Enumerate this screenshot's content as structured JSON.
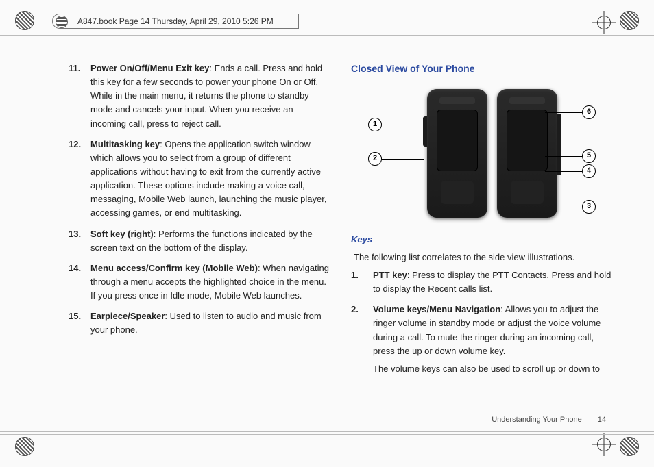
{
  "header": {
    "text": "A847.book  Page 14  Thursday, April 29, 2010  5:26 PM"
  },
  "left_items": [
    {
      "num": "11.",
      "term": "Power On/Off/Menu Exit key",
      "desc": ": Ends a call. Press and hold this key for a few seconds to power your phone On or Off. While in the main menu, it returns the phone to standby mode and cancels your input. When you receive an incoming call, press to reject call."
    },
    {
      "num": "12.",
      "term": "Multitasking key",
      "desc": ": Opens the application switch window which allows you to select from a group of different applications without having to exit from the currently active application. These options include making a voice call, messaging, Mobile Web launch, launching the music player, accessing games, or end multitasking."
    },
    {
      "num": "13.",
      "term": "Soft key (right)",
      "desc": ": Performs the functions indicated by the screen text on the bottom of the display."
    },
    {
      "num": "14.",
      "term": "Menu access/Confirm key (Mobile Web)",
      "desc": ": When navigating through a menu accepts the highlighted choice in the menu. If you press once in Idle mode, Mobile Web launches."
    },
    {
      "num": "15.",
      "term": "Earpiece/Speaker",
      "desc": ": Used to listen to audio and music from your phone."
    }
  ],
  "right": {
    "section_title": "Closed View of Your Phone",
    "sub_title": "Keys",
    "intro": "The following list correlates to the side view illustrations.",
    "items": [
      {
        "num": "1.",
        "term": "PTT key",
        "desc": ": Press to display the PTT Contacts. Press and hold to display the Recent calls list."
      },
      {
        "num": "2.",
        "term": "Volume keys/Menu Navigation",
        "desc": ": Allows you to adjust the ringer volume in standby mode or adjust the voice volume during a call. To mute the ringer during an incoming call, press the up or down volume key.",
        "desc2": "The volume keys can also be used to scroll up or down to"
      }
    ],
    "callouts": {
      "c1": "1",
      "c2": "2",
      "c3": "3",
      "c4": "4",
      "c5": "5",
      "c6": "6"
    }
  },
  "footer": {
    "label": "Understanding Your Phone",
    "page": "14"
  }
}
